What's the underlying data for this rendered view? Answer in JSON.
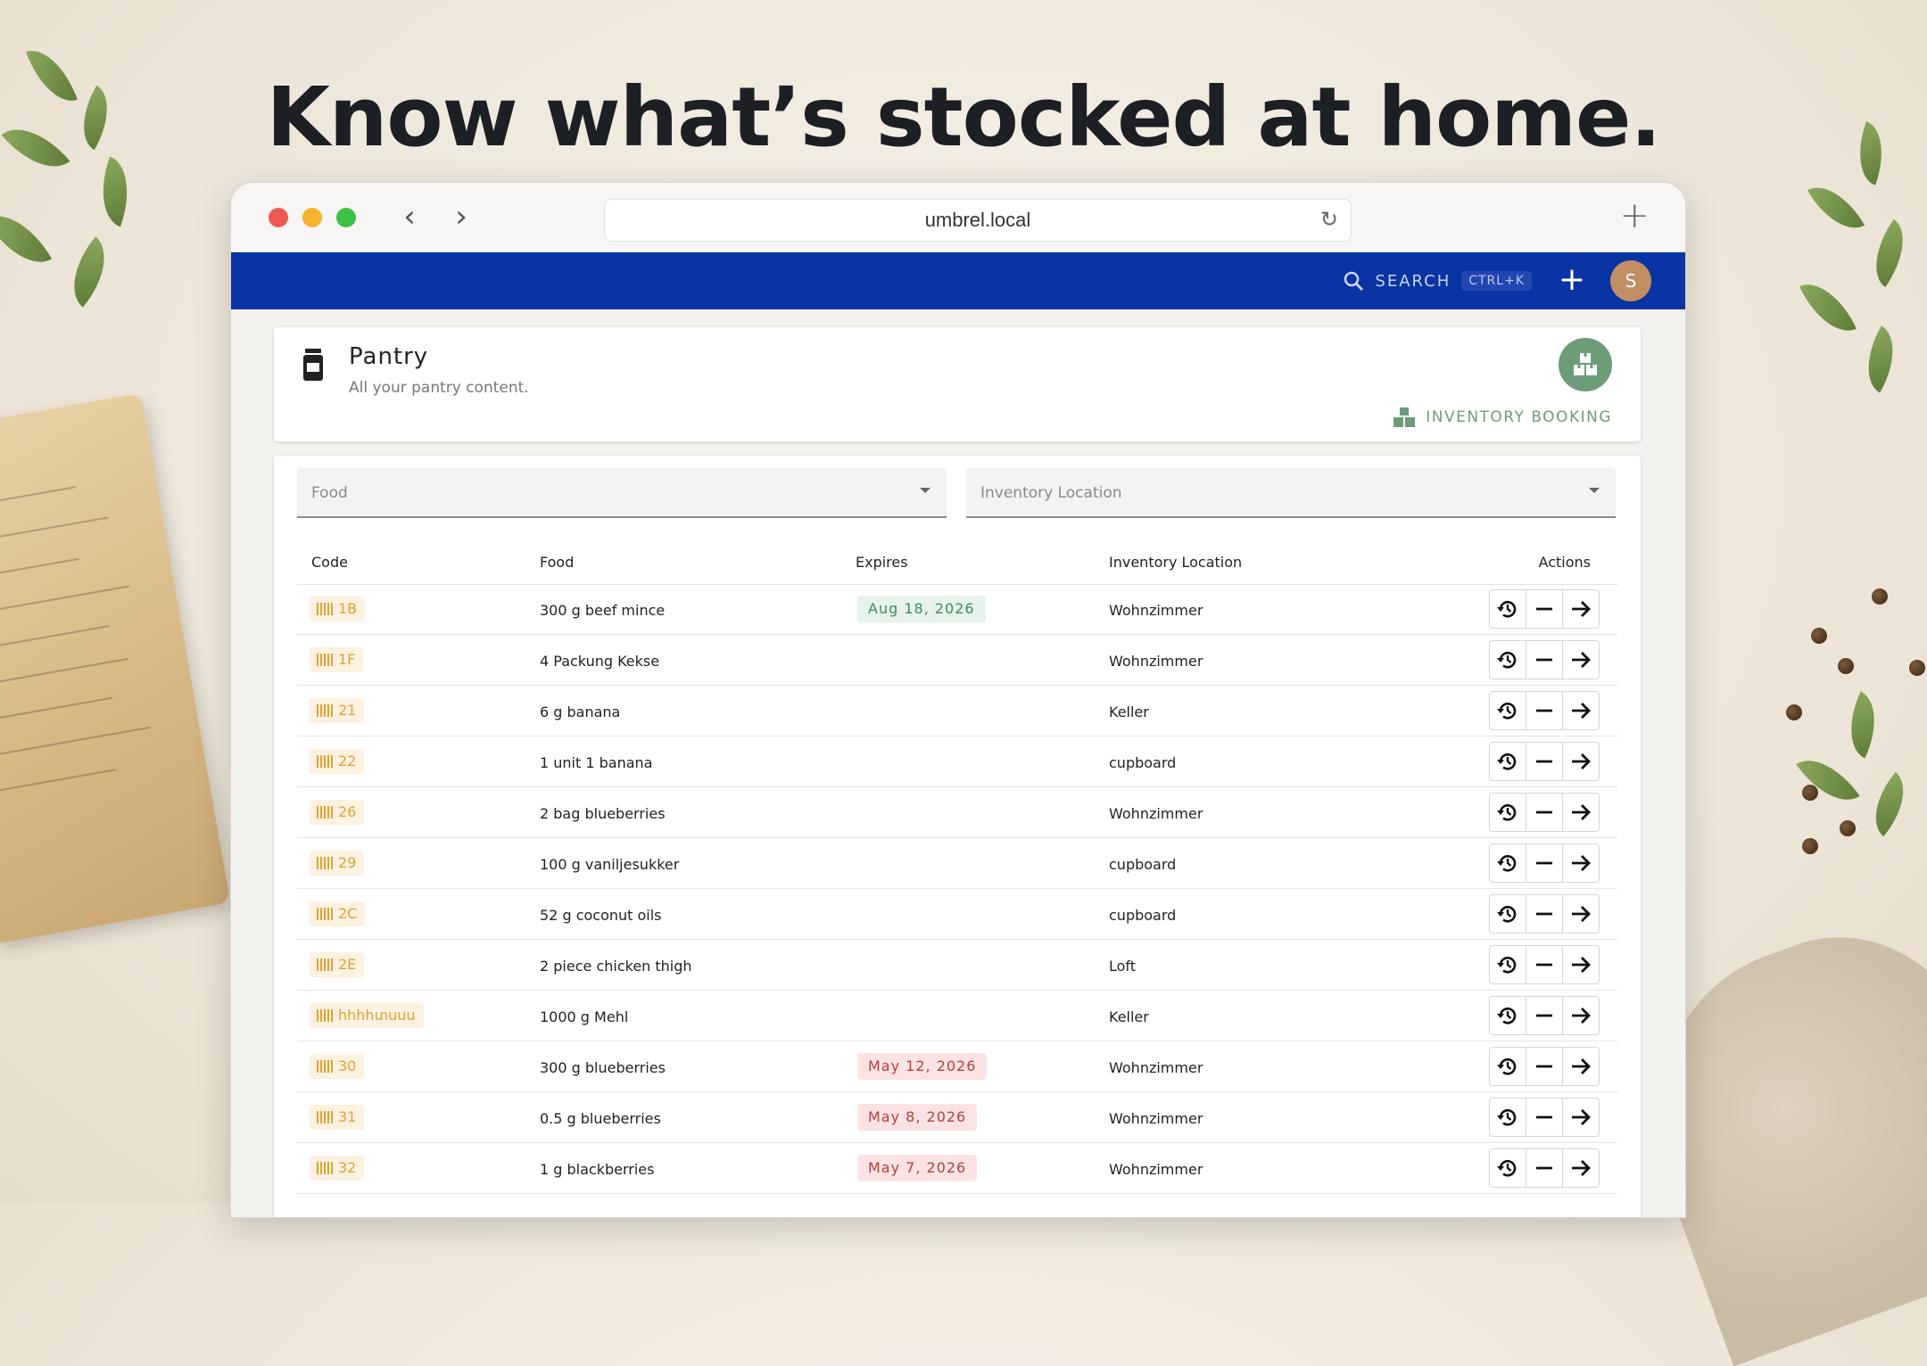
{
  "headline": "Know what’s stocked at home.",
  "browser": {
    "url": "umbrel.local"
  },
  "appbar": {
    "search_label": "SEARCH",
    "search_shortcut": "CTRL+K",
    "avatar_initial": "S",
    "color": "#0a33a3"
  },
  "page": {
    "title": "Pantry",
    "subtitle": "All your pantry content.",
    "booking_label": "INVENTORY BOOKING"
  },
  "filters": {
    "food_placeholder": "Food",
    "location_placeholder": "Inventory Location"
  },
  "table": {
    "headers": {
      "code": "Code",
      "food": "Food",
      "expires": "Expires",
      "location": "Inventory Location",
      "actions": "Actions"
    },
    "rows": [
      {
        "code": "1B",
        "food": "300 g beef mince",
        "expires": "Aug 18, 2026",
        "expires_status": "ok",
        "location": "Wohnzimmer"
      },
      {
        "code": "1F",
        "food": "4 Packung Kekse",
        "expires": "",
        "expires_status": "none",
        "location": "Wohnzimmer"
      },
      {
        "code": "21",
        "food": "6 g banana",
        "expires": "",
        "expires_status": "none",
        "location": "Keller"
      },
      {
        "code": "22",
        "food": "1 unit 1 banana",
        "expires": "",
        "expires_status": "none",
        "location": "cupboard"
      },
      {
        "code": "26",
        "food": "2 bag blueberries",
        "expires": "",
        "expires_status": "none",
        "location": "Wohnzimmer"
      },
      {
        "code": "29",
        "food": "100 g vaniljesukker",
        "expires": "",
        "expires_status": "none",
        "location": "cupboard"
      },
      {
        "code": "2C",
        "food": "52 g coconut oils",
        "expires": "",
        "expires_status": "none",
        "location": "cupboard"
      },
      {
        "code": "2E",
        "food": "2 piece chicken thigh",
        "expires": "",
        "expires_status": "none",
        "location": "Loft"
      },
      {
        "code": "hhhhտuuu",
        "food": "1000 g Mehl",
        "expires": "",
        "expires_status": "none",
        "location": "Keller"
      },
      {
        "code": "30",
        "food": "300 g blueberries",
        "expires": "May 12, 2026",
        "expires_status": "expired",
        "location": "Wohnzimmer"
      },
      {
        "code": "31",
        "food": "0.5 g blueberries",
        "expires": "May 8, 2026",
        "expires_status": "expired",
        "location": "Wohnzimmer"
      },
      {
        "code": "32",
        "food": "1 g blackberries",
        "expires": "May 7, 2026",
        "expires_status": "expired",
        "location": "Wohnzimmer"
      }
    ]
  },
  "colors": {
    "ok_bg": "#e6f3ea",
    "ok_fg": "#3f8a5a",
    "expired_bg": "#fbe3e3",
    "expired_fg": "#b3403a",
    "accent_green": "#6d9c78"
  }
}
